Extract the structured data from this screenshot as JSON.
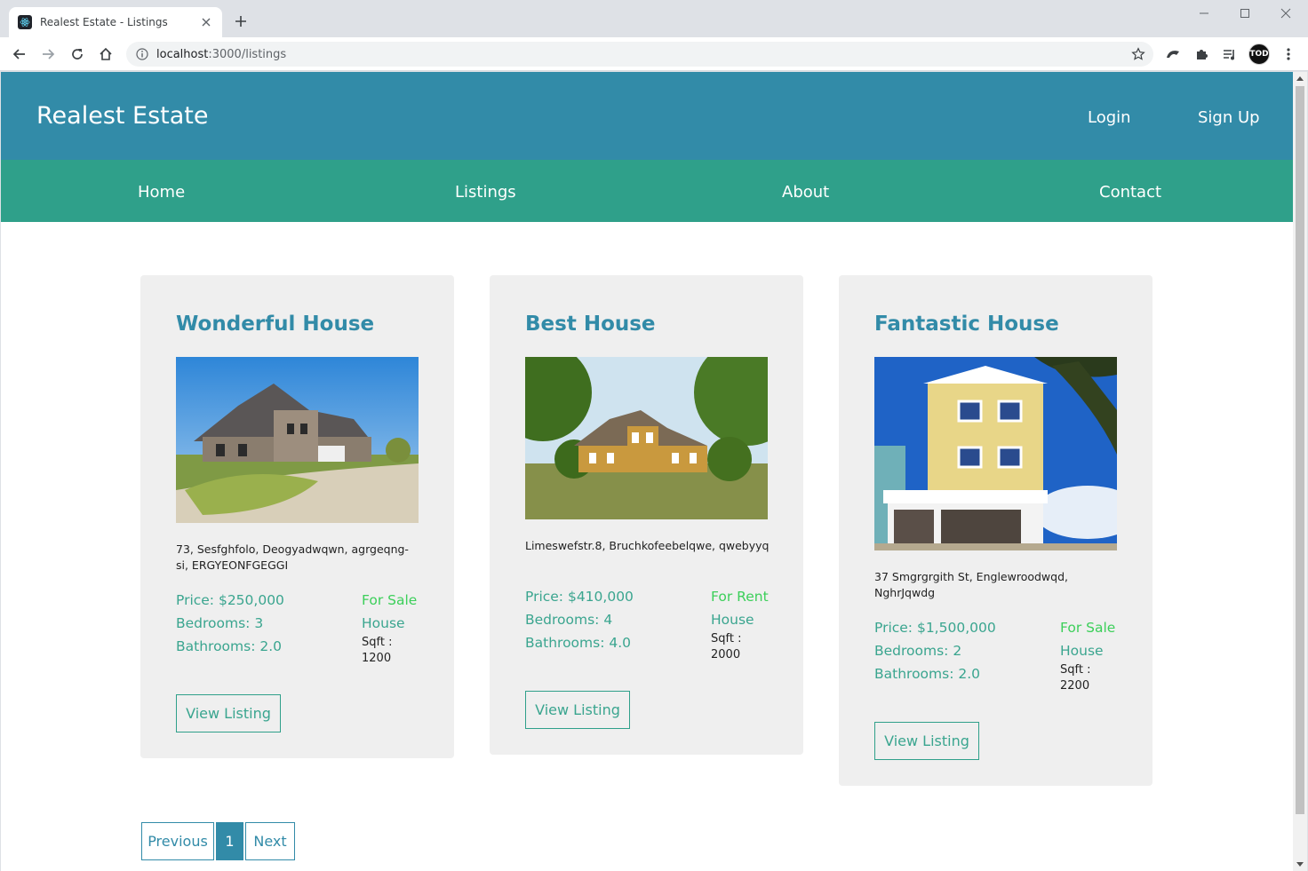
{
  "browser": {
    "tab_title": "Realest Estate - Listings",
    "url_host": "localhost",
    "url_rest": ":3000/listings",
    "profile_initials": "TOD"
  },
  "header": {
    "brand": "Realest Estate",
    "login": "Login",
    "signup": "Sign Up"
  },
  "nav": {
    "home": "Home",
    "listings": "Listings",
    "about": "About",
    "contact": "Contact"
  },
  "listings": [
    {
      "title": "Wonderful House",
      "address": "73, Sesfghfolo, Deogyadwqwn, agrgeqng-si, ERGYEONFGEGGI",
      "price": "Price: $250,000",
      "bedrooms": "Bedrooms: 3",
      "bathrooms": "Bathrooms: 2.0",
      "status": "For Sale",
      "type": "House",
      "sqft_label": "Sqft :",
      "sqft": "1200",
      "button": "View Listing"
    },
    {
      "title": "Best House",
      "address": "Limeswefstr.8, Bruchkofeebelqwe, qwebyyq",
      "price": "Price: $410,000",
      "bedrooms": "Bedrooms: 4",
      "bathrooms": "Bathrooms: 4.0",
      "status": "For Rent",
      "type": "House",
      "sqft_label": "Sqft :",
      "sqft": "2000",
      "button": "View Listing"
    },
    {
      "title": "Fantastic House",
      "address": "37 Smgrgrgith St, Englewroodwqd, NghrJqwdg",
      "price": "Price: $1,500,000",
      "bedrooms": "Bedrooms: 2",
      "bathrooms": "Bathrooms: 2.0",
      "status": "For Sale",
      "type": "House",
      "sqft_label": "Sqft :",
      "sqft": "2200",
      "button": "View Listing"
    }
  ],
  "pagination": {
    "previous": "Previous",
    "current": "1",
    "next": "Next"
  },
  "colors": {
    "header_blue": "#328ba8",
    "nav_green": "#2fa08a",
    "status_green": "#3ccf5a"
  }
}
